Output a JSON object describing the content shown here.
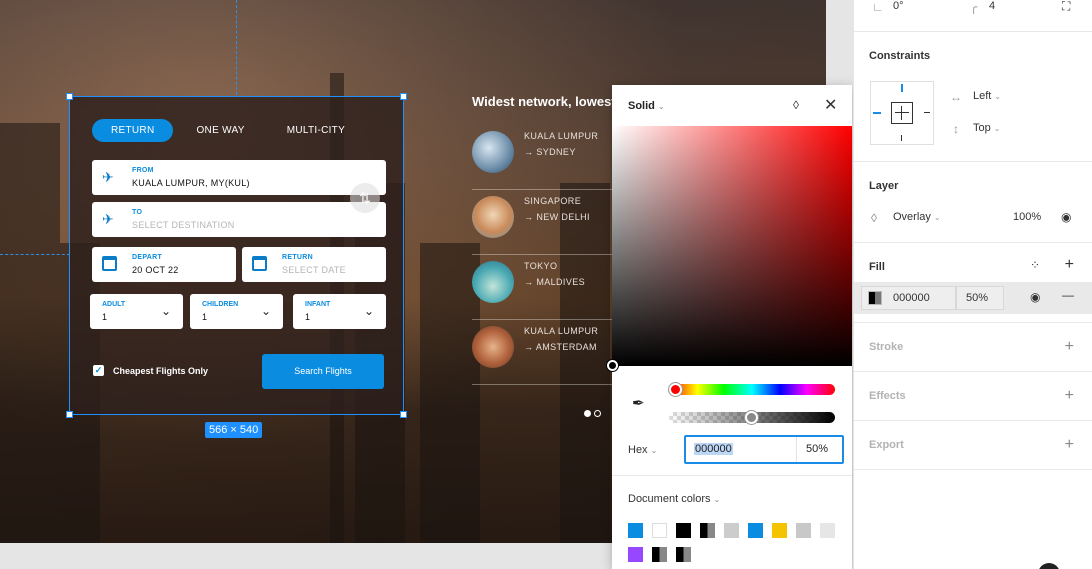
{
  "canvas": {
    "size_badge": "566 × 540"
  },
  "search_card": {
    "tabs": [
      {
        "label": "RETURN",
        "active": true
      },
      {
        "label": "ONE WAY",
        "active": false
      },
      {
        "label": "MULTI-CITY",
        "active": false
      }
    ],
    "from": {
      "label": "FROM",
      "value": "KUALA LUMPUR, MY(KUL)"
    },
    "to": {
      "label": "TO",
      "placeholder": "SELECT DESTINATION"
    },
    "depart": {
      "label": "DEPART",
      "value": "20 OCT 22"
    },
    "return": {
      "label": "RETURN",
      "placeholder": "SELECT DATE"
    },
    "adult": {
      "label": "ADULT",
      "value": "1"
    },
    "children": {
      "label": "CHILDREN",
      "value": "1"
    },
    "infant": {
      "label": "INFANT",
      "value": "1"
    },
    "cheapest_label": "Cheapest Flights Only",
    "search_label": "Search Flights"
  },
  "destinations": {
    "title": "Widest network, lowest",
    "items": [
      {
        "from": "KUALA LUMPUR",
        "to": "SYDNEY",
        "color": "#6b8ca8"
      },
      {
        "from": "SINGAPORE",
        "to": "NEW DELHI",
        "color": "#c98a5a"
      },
      {
        "from": "TOKYO",
        "to": "MALDIVES",
        "color": "#4aa9b3"
      },
      {
        "from": "KUALA LUMPUR",
        "to": "AMSTERDAM",
        "color": "#b0613b"
      }
    ],
    "arrow": "→"
  },
  "picker": {
    "mode": "Solid",
    "hex_label": "Hex",
    "hex_value": "000000",
    "opacity": "50%",
    "doc_colors_label": "Document colors",
    "swatches": [
      "#0a8ce0",
      "#ffffff",
      "#000000",
      "half",
      "#cccccc",
      "#0a8ce0",
      "#f5c400",
      "#c8c8c8",
      "#e6e6e6",
      "#9747ff",
      "half",
      "half"
    ]
  },
  "panel": {
    "rotation": "0°",
    "radius": "4",
    "constraints_title": "Constraints",
    "constraint_h": "Left",
    "constraint_v": "Top",
    "layer_title": "Layer",
    "blend_mode": "Overlay",
    "layer_opacity": "100%",
    "fill_title": "Fill",
    "fill_hex": "000000",
    "fill_opacity": "50%",
    "stroke_title": "Stroke",
    "effects_title": "Effects",
    "export_title": "Export"
  }
}
